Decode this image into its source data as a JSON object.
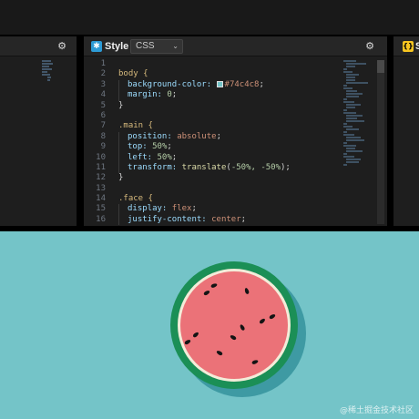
{
  "style_pane": {
    "title": "Style",
    "badge_icon": "css3-icon",
    "language": "CSS",
    "settings_icon": "gear-icon"
  },
  "js_pane": {
    "title": "S",
    "badge_icon": "js-icon"
  },
  "left_pane": {
    "settings_icon": "gear-icon"
  },
  "code_lines": [
    "1",
    "2",
    "3",
    "4",
    "5",
    "6",
    "7",
    "8",
    "9",
    "10",
    "11",
    "12",
    "13",
    "14",
    "15",
    "16"
  ],
  "code": {
    "l2": "body {",
    "l3_prop": "background-color:",
    "l3_val": "#74c4c8",
    "l4_prop": "margin:",
    "l4_val": "0",
    "l5": "}",
    "l7": ".main {",
    "l8_prop": "position:",
    "l8_val": "absolute",
    "l9_prop": "top:",
    "l9_val": "50%",
    "l10_prop": "left:",
    "l10_val": "50%",
    "l11_prop": "transform:",
    "l11_fn": "translate",
    "l11_args": "-50%, -50%",
    "l12": "}",
    "l14": ".face {",
    "l15_prop": "display:",
    "l15_val": "flex",
    "l16_prop": "justify-content:",
    "l16_val": "center"
  },
  "colors": {
    "background": "#74c4c8",
    "rind": "#1b8f56",
    "flesh": "#eb7278",
    "seed": "#141414"
  },
  "watermark": "@稀土掘金技术社区"
}
